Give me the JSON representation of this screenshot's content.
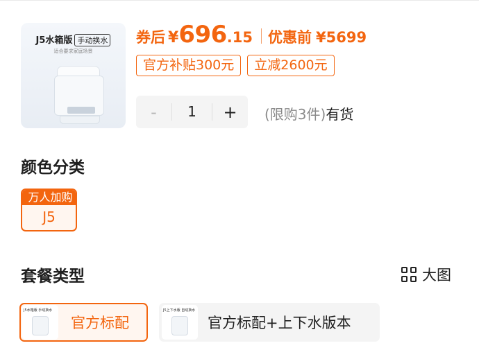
{
  "product": {
    "thumb_title": "J5水箱版",
    "thumb_tag": "手动换水",
    "thumb_subtitle": "适合要求家庭场景"
  },
  "price": {
    "coupon_label": "券后",
    "currency": "¥",
    "integer": "696",
    "decimal": ".15",
    "original_label": "优惠前",
    "original_price": "¥5699"
  },
  "promo_tags": [
    "官方补贴300元",
    "立减2600元"
  ],
  "quantity": {
    "minus": "-",
    "value": "1",
    "plus": "+",
    "limit_text": "(限购3件)",
    "stock_text": "有货"
  },
  "color_section": {
    "title": "颜色分类",
    "options": [
      {
        "badge": "万人加购",
        "label": "J5",
        "selected": true
      }
    ]
  },
  "package_section": {
    "title": "套餐类型",
    "view_toggle_label": "大图",
    "view_toggle_icon": "grid-icon",
    "options": [
      {
        "label": "官方标配",
        "thumb_text": "J5水箱版 手动换水",
        "selected": true
      },
      {
        "label": "官方标配+上下水版本",
        "thumb_text": "J5上下水版 自动换水",
        "selected": false
      }
    ]
  },
  "colors": {
    "accent": "#f3650f",
    "accent_bg": "#fff6f0",
    "text": "#1f1f1f",
    "muted": "#8a8a8a",
    "chip_bg": "#f4f4f4"
  }
}
